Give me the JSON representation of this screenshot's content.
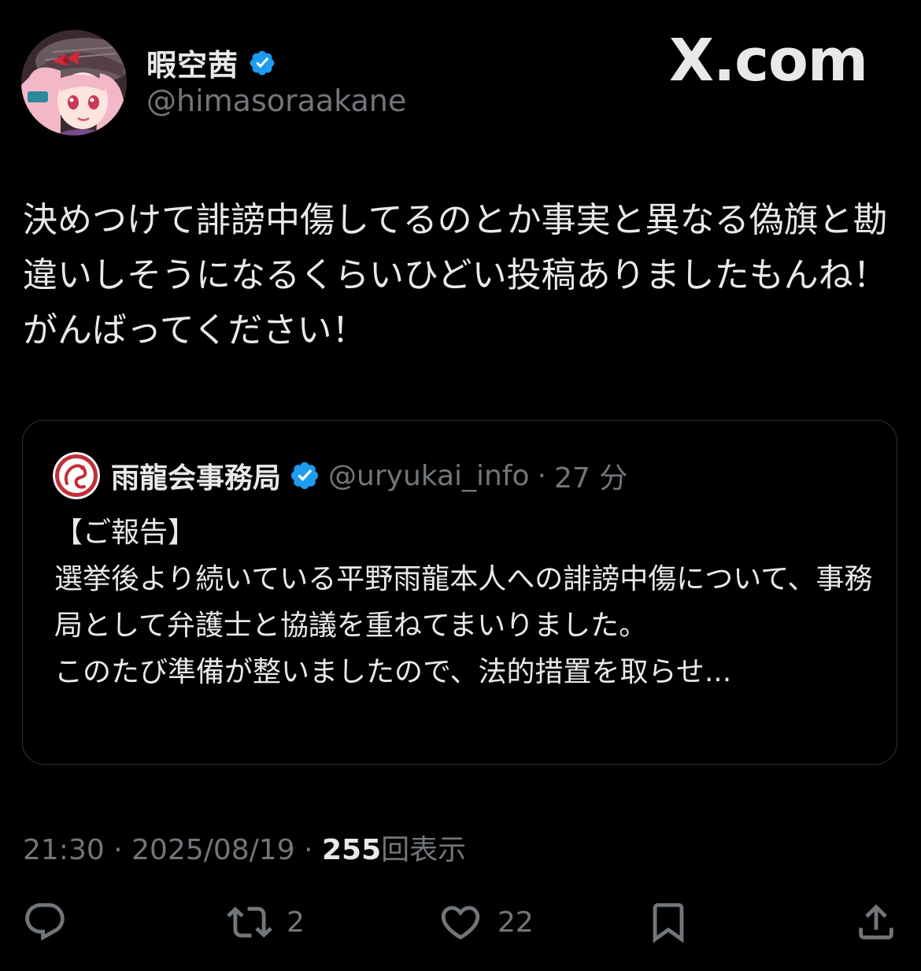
{
  "header": {
    "display_name": "暇空茜",
    "handle": "@himasoraakane",
    "brand": "X.com"
  },
  "tweet": {
    "text": "決めつけて誹謗中傷してるのとか事実と異なる偽旗と勘違いしそうになるくらいひどい投稿ありましたもんね！がんばってください！"
  },
  "quote": {
    "name": "雨龍会事務局",
    "handle": "@uryukai_info",
    "separator": "·",
    "time": "27 分",
    "text": "【ご報告】\n選挙後より続いている平野雨龍本人への誹謗中傷について、事務局として弁護士と協議を重ねてまいりました。\nこのたび準備が整いましたので、法的措置を取らせ..."
  },
  "meta": {
    "time": "21:30",
    "separator": "·",
    "date": "2025/08/19",
    "views_count": "255",
    "views_label": "回表示"
  },
  "actions": {
    "reply_count": "",
    "retweet_count": "2",
    "like_count": "22"
  },
  "colors": {
    "background": "#000000",
    "text": "#e7e9ea",
    "muted": "#71767b",
    "verified": "#1d9bf0",
    "border": "#2f3336"
  }
}
